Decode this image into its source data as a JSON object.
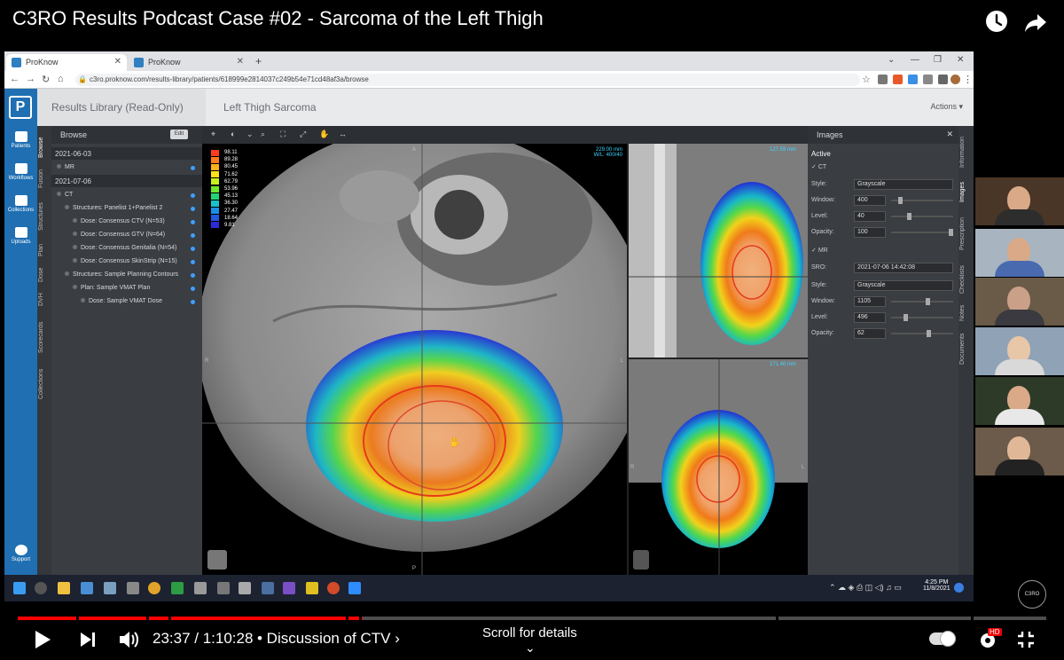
{
  "video": {
    "title": "C3RO Results Podcast Case #02 - Sarcoma of the Left Thigh",
    "time_current": "23:37",
    "time_total": "1:10:28",
    "time_sep": " / ",
    "chapter": "• Discussion of CTV ›",
    "scroll_hint": "Scroll for details",
    "progress_fraction": 0.335,
    "hd_badge": "HD",
    "watermark": "C3RO"
  },
  "browser": {
    "tabs": [
      {
        "label": "ProKnow",
        "active": true
      },
      {
        "label": "ProKnow",
        "active": false
      }
    ],
    "new_tab": "+",
    "url": "c3ro.proknow.com/results-library/patients/618999e2814037c249b54e71cd48af3a/browse"
  },
  "app": {
    "library_title": "Results Library (Read-Only)",
    "case_title": "Left Thigh Sarcoma",
    "actions": "Actions ▾",
    "nav": [
      "Patients",
      "Workflows",
      "Collections",
      "Uploads",
      "Support"
    ],
    "side_tabs": [
      "Browse",
      "Fusion",
      "Structures",
      "Plan",
      "Dose",
      "DVH",
      "Scorecards",
      "Collections"
    ],
    "right_tabs": [
      "Information",
      "Images",
      "Prescription",
      "Checklists",
      "Notes",
      "Documents"
    ],
    "browse": {
      "header": "Browse",
      "edit": "Edit",
      "rows": [
        {
          "text": "2021-06-03",
          "kind": "date"
        },
        {
          "text": "MR",
          "kind": "item",
          "indent": 0
        },
        {
          "text": "2021-07-06",
          "kind": "date"
        },
        {
          "text": "CT",
          "kind": "item",
          "indent": 0
        },
        {
          "text": "Structures: Panelist 1+Panelist 2",
          "kind": "item",
          "indent": 1
        },
        {
          "text": "Dose: Consensus CTV (N=53)",
          "kind": "item",
          "indent": 2
        },
        {
          "text": "Dose: Consensus GTV (N=64)",
          "kind": "item",
          "indent": 2
        },
        {
          "text": "Dose: Consensus Genitalia (N=54)",
          "kind": "item",
          "indent": 2
        },
        {
          "text": "Dose: Consensus SkinStrip (N=15)",
          "kind": "item",
          "indent": 2
        },
        {
          "text": "Structures: Sample Planning Contours",
          "kind": "item",
          "indent": 1
        },
        {
          "text": "Plan: Sample VMAT Plan",
          "kind": "item",
          "indent": 2
        },
        {
          "text": "Dose: Sample VMAT Dose",
          "kind": "item",
          "indent": 3
        }
      ]
    },
    "viewer": {
      "legend": [
        "98.11",
        "89.28",
        "80.45",
        "71.62",
        "62.79",
        "53.96",
        "45.13",
        "36.30",
        "27.47",
        "18.64",
        "9.81"
      ],
      "legend_colors": [
        "#ff3b1f",
        "#ff7a1a",
        "#ffb11a",
        "#ffe01a",
        "#c8f01a",
        "#6ee82a",
        "#22d37a",
        "#19c2c9",
        "#1a8fe8",
        "#2358e0",
        "#2a2ad8"
      ],
      "axial_info": [
        "229.00 mm",
        "W/L: 400/40"
      ],
      "sag_info": "127.59 mm",
      "cor_info": "171.40 mm",
      "orient": {
        "a": "A",
        "p": "P",
        "r": "R",
        "l": "L"
      }
    },
    "images": {
      "header": "Images",
      "active": "Active",
      "ct": {
        "name": "CT",
        "style_label": "Style:",
        "style": "Grayscale",
        "window_label": "Window:",
        "window": "400",
        "window_level": 0.12,
        "level_label": "Level:",
        "level": "40",
        "level_level": 0.28,
        "opacity_label": "Opacity:",
        "opacity": "100",
        "opacity_level": 1.0
      },
      "mr": {
        "name": "MR",
        "sro_label": "SRO:",
        "sro": "2021-07-06 14:42:08",
        "style_label": "Style:",
        "style": "Grayscale",
        "window_label": "Window:",
        "window": "1105",
        "window_level": 0.6,
        "level_label": "Level:",
        "level": "496",
        "level_level": 0.22,
        "opacity_label": "Opacity:",
        "opacity": "62",
        "opacity_level": 0.62
      }
    },
    "taskbar": {
      "time": "4:25 PM",
      "date": "11/8/2021"
    }
  }
}
